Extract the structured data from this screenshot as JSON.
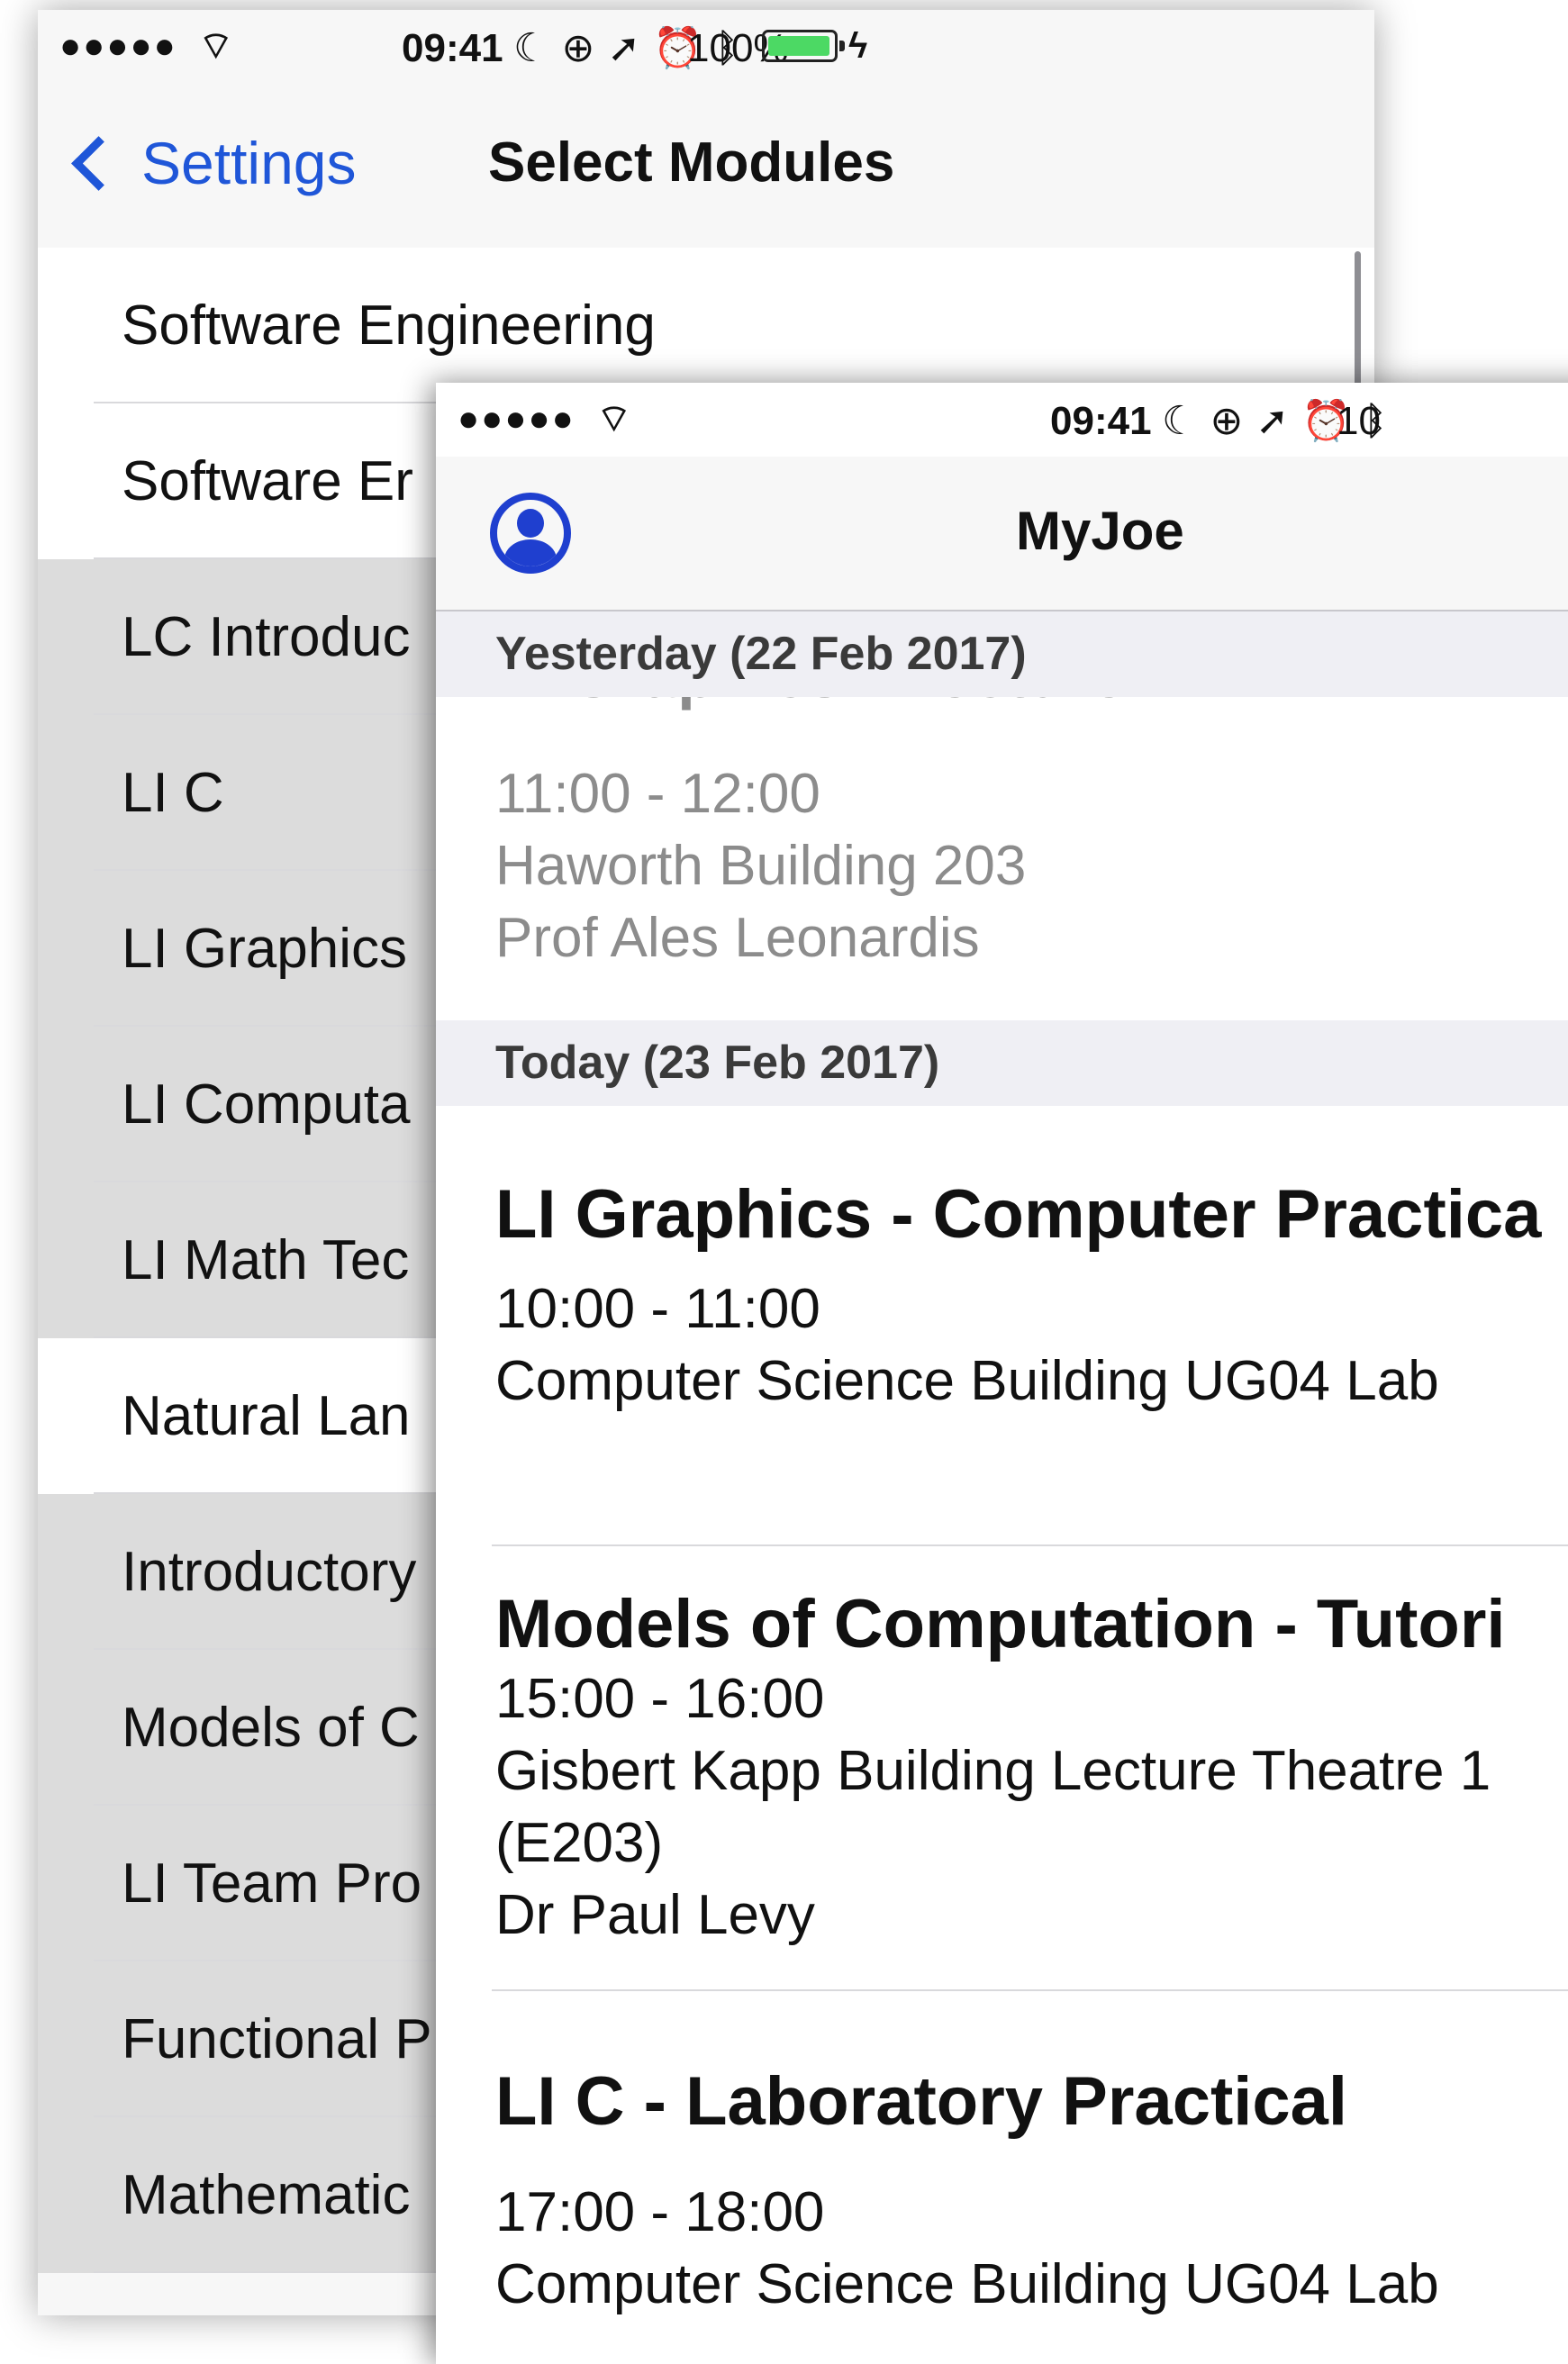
{
  "status_bar": {
    "signal": "●●●●●",
    "time": "09:41",
    "battery_percent": "100%",
    "battery_level": 1.0,
    "icons": [
      "moon-icon",
      "orientation-lock-icon",
      "location-arrow-icon",
      "alarm-icon",
      "bluetooth-icon"
    ]
  },
  "modules_screen": {
    "back_label": "Settings",
    "title": "Select Modules",
    "modules": [
      {
        "label": "Software Engineering",
        "selected": true
      },
      {
        "label": "Software Er",
        "selected": true
      },
      {
        "label": "LC Introduc",
        "selected": false
      },
      {
        "label": "LI C",
        "selected": false
      },
      {
        "label": "LI Graphics",
        "selected": false
      },
      {
        "label": "LI Computa",
        "selected": false
      },
      {
        "label": "LI Math Tec",
        "selected": false
      },
      {
        "label": "Natural Lan",
        "selected": true
      },
      {
        "label": "Introductory",
        "selected": false
      },
      {
        "label": "Models of C",
        "selected": false
      },
      {
        "label": "LI Team Pro",
        "selected": false
      },
      {
        "label": "Functional P",
        "selected": false
      },
      {
        "label": "Mathematic",
        "selected": false
      }
    ]
  },
  "myjoe_screen": {
    "status_time": "09:41",
    "status_batt_partial": "10",
    "title": "MyJoe",
    "yesterday_header": "Yesterday (22 Feb 2017)",
    "yesterday_event": {
      "title_partial": "LI Graphics - Lecture",
      "time": "11:00 - 12:00",
      "location": "Haworth Building 203",
      "lecturer": "Prof Ales Leonardis"
    },
    "today_header": "Today (23 Feb 2017)",
    "events": [
      {
        "title": "LI Graphics - Computer Practica",
        "time": "10:00 - 11:00",
        "location": "Computer Science Building UG04 Lab"
      },
      {
        "title": "Models of Computation  - Tutori",
        "time": "15:00 - 16:00",
        "location_line1": "Gisbert Kapp Building Lecture Theatre 1",
        "location_line2": "(E203)",
        "lecturer": "Dr Paul Levy"
      },
      {
        "title": "LI C - Laboratory Practical",
        "time": "17:00 - 18:00",
        "location": "Computer Science Building UG04 Lab"
      }
    ]
  }
}
